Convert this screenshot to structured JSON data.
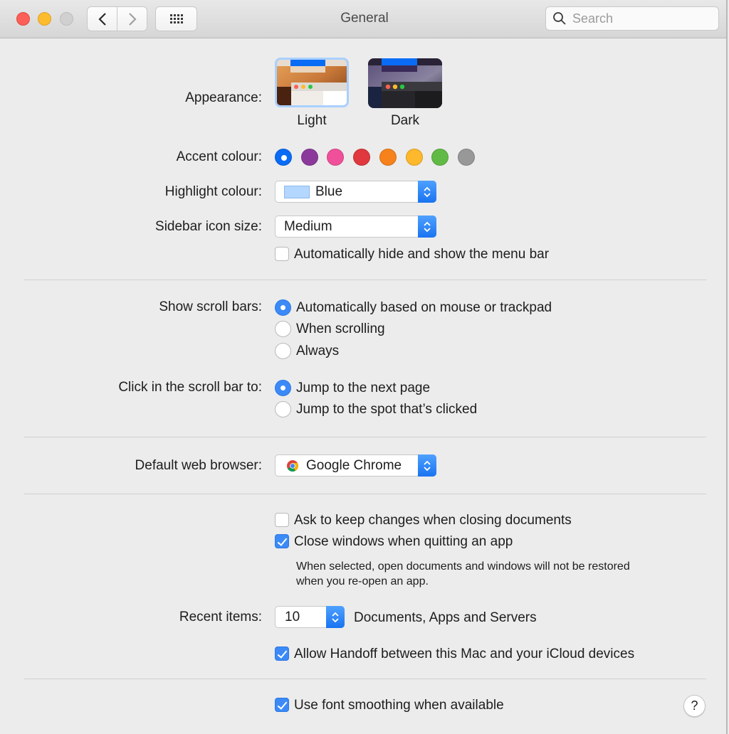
{
  "window": {
    "title": "General",
    "search_placeholder": "Search"
  },
  "appearance": {
    "label": "Appearance:",
    "options": [
      {
        "name": "Light",
        "selected": true
      },
      {
        "name": "Dark",
        "selected": false
      }
    ]
  },
  "accent": {
    "label": "Accent colour:",
    "colors": [
      {
        "name": "blue",
        "hex": "#0a6cf5",
        "selected": true
      },
      {
        "name": "purple",
        "hex": "#8b3a9c",
        "selected": false
      },
      {
        "name": "pink",
        "hex": "#f0509a",
        "selected": false
      },
      {
        "name": "red",
        "hex": "#e0383e",
        "selected": false
      },
      {
        "name": "orange",
        "hex": "#f7821b",
        "selected": false
      },
      {
        "name": "yellow",
        "hex": "#fdb82b",
        "selected": false
      },
      {
        "name": "green",
        "hex": "#62ba46",
        "selected": false
      },
      {
        "name": "graphite",
        "hex": "#989898",
        "selected": false
      }
    ]
  },
  "highlight": {
    "label": "Highlight colour:",
    "value": "Blue",
    "swatch_hex": "#b3d7ff"
  },
  "sidebar_icon_size": {
    "label": "Sidebar icon size:",
    "value": "Medium"
  },
  "menu_bar": {
    "label": "Automatically hide and show the menu bar",
    "checked": false
  },
  "scroll_bars": {
    "label": "Show scroll bars:",
    "options": [
      {
        "label": "Automatically based on mouse or trackpad",
        "selected": true
      },
      {
        "label": "When scrolling",
        "selected": false
      },
      {
        "label": "Always",
        "selected": false
      }
    ]
  },
  "click_scroll": {
    "label": "Click in the scroll bar to:",
    "options": [
      {
        "label": "Jump to the next page",
        "selected": true
      },
      {
        "label": "Jump to the spot that’s clicked",
        "selected": false
      }
    ]
  },
  "browser": {
    "label": "Default web browser:",
    "value": "Google Chrome"
  },
  "documents": {
    "ask_keep_changes": {
      "label": "Ask to keep changes when closing documents",
      "checked": false
    },
    "close_windows": {
      "label": "Close windows when quitting an app",
      "checked": true
    },
    "note_line1": "When selected, open documents and windows will not be restored",
    "note_line2": "when you re-open an app."
  },
  "recent_items": {
    "label": "Recent items:",
    "value": "10",
    "suffix": "Documents, Apps and Servers"
  },
  "handoff": {
    "label": "Allow Handoff between this Mac and your iCloud devices",
    "checked": true
  },
  "font_smoothing": {
    "label": "Use font smoothing when available",
    "checked": true
  },
  "help_label": "?"
}
